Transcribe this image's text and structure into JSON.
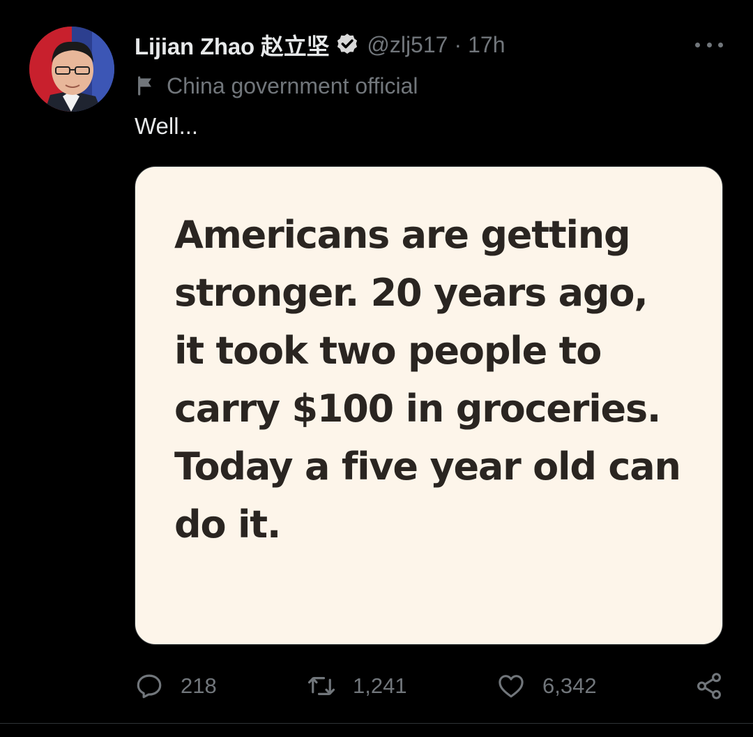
{
  "author": {
    "display_name": "Lijian Zhao 赵立坚",
    "handle": "@zlj517",
    "separator": "·",
    "time": "17h",
    "verified_icon": "verified-badge-icon",
    "avatar_icon": "avatar"
  },
  "label": {
    "icon": "flag-icon",
    "text": "China government official"
  },
  "tweet": {
    "text": "Well..."
  },
  "media": {
    "text": "Americans are getting\nstronger.  20 years ago,\nit took two people to\ncarry $100 in groceries.\nToday a five year old can\ndo it."
  },
  "actions": {
    "reply": {
      "icon": "reply-icon",
      "count": "218"
    },
    "retweet": {
      "icon": "retweet-icon",
      "count": "1,241"
    },
    "like": {
      "icon": "heart-icon",
      "count": "6,342"
    },
    "share": {
      "icon": "share-icon"
    }
  },
  "colors": {
    "background": "#000000",
    "primary_text": "#e7e9ea",
    "secondary_text": "#71767b",
    "media_background": "#fdf5ea",
    "media_text": "#2a2521"
  }
}
